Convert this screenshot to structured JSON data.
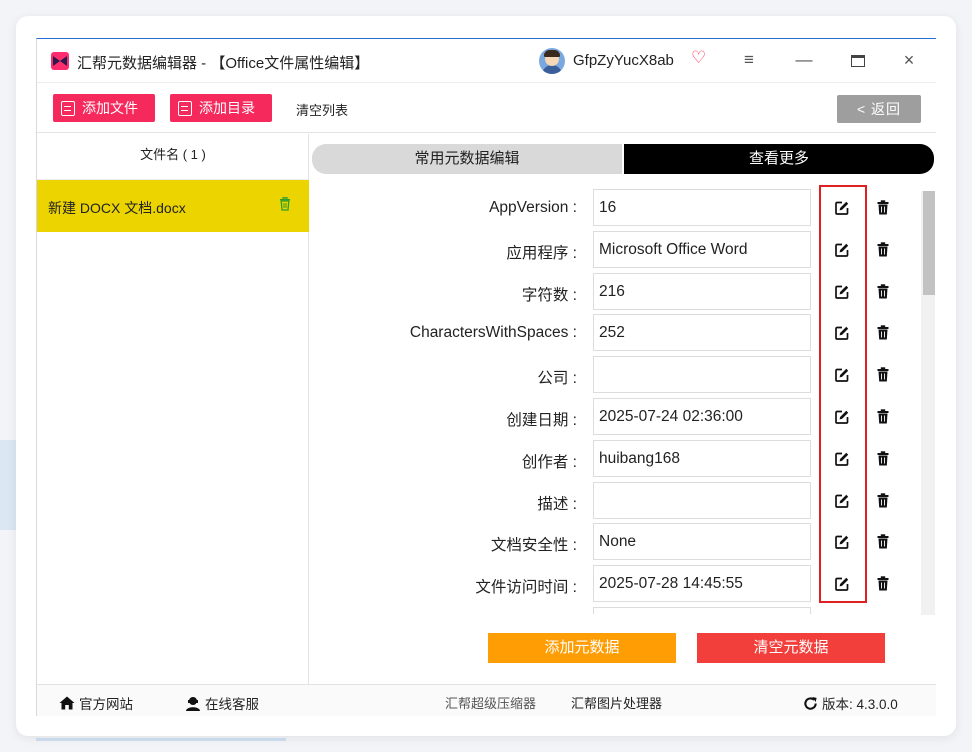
{
  "window": {
    "title": "汇帮元数据编辑器 - 【Office文件属性编辑】",
    "username": "GfpZyYucX8ab",
    "icons": {
      "logo": "app-logo-icon",
      "vip": "heart-vip-icon",
      "menu": "hamburger-icon",
      "minimize": "minimize-icon",
      "maximize": "maximize-icon",
      "close": "close-icon"
    },
    "menu_glyph": "≡",
    "minimize_glyph": "—",
    "close_glyph": "×",
    "vip_glyph": "♡"
  },
  "toolbar": {
    "add_file": "添加文件",
    "add_dir": "添加目录",
    "clear_list": "清空列表",
    "back": "< 返回"
  },
  "file_list": {
    "header": "文件名 ( 1 )",
    "files": [
      {
        "name": "新建 DOCX 文档.docx",
        "selected": true
      }
    ]
  },
  "tabs": {
    "common": "常用元数据编辑",
    "more": "查看更多"
  },
  "metadata": [
    {
      "label": "AppVersion :",
      "value": "16"
    },
    {
      "label": "应用程序 :",
      "value": "Microsoft Office Word"
    },
    {
      "label": "字符数 :",
      "value": "216"
    },
    {
      "label": "CharactersWithSpaces :",
      "value": "252"
    },
    {
      "label": "公司 :",
      "value": ""
    },
    {
      "label": "创建日期 :",
      "value": "2025-07-24 02:36:00"
    },
    {
      "label": "创作者 :",
      "value": "huibang168"
    },
    {
      "label": "描述 :",
      "value": ""
    },
    {
      "label": "文档安全性 :",
      "value": "None"
    },
    {
      "label": "文件访问时间 :",
      "value": "2025-07-28 14:45:55"
    },
    {
      "label": "",
      "value": ""
    }
  ],
  "actions": {
    "add_meta": "添加元数据",
    "clear_meta": "清空元数据"
  },
  "footer": {
    "home": "官方网站",
    "service": "在线客服",
    "compress": "汇帮超级压缩器",
    "image": "汇帮图片处理器",
    "version": "版本: 4.3.0.0"
  },
  "colors": {
    "accent_pink": "#f5295c",
    "selected_row": "#ecd400",
    "add_button": "#ff9d05",
    "clear_button": "#f23f3b",
    "highlight_frame": "#e02020"
  }
}
